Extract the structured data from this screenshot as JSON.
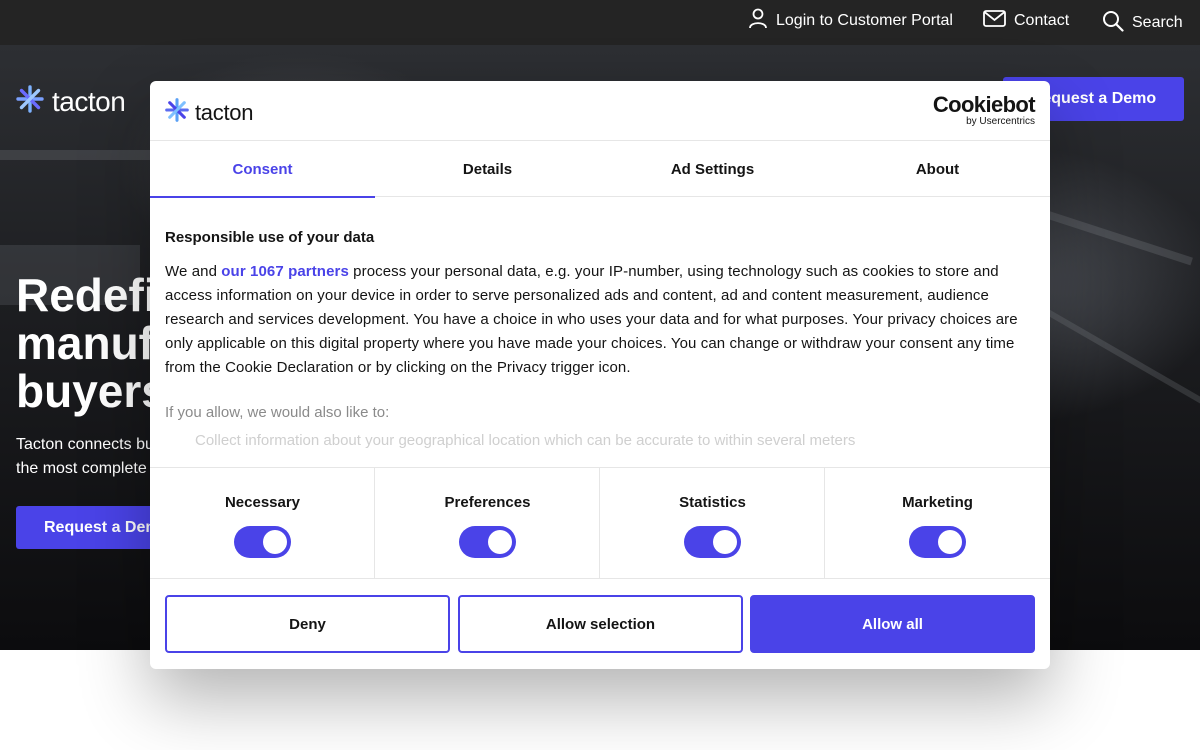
{
  "topbar": {
    "login_label": "Login to Customer Portal",
    "contact_label": "Contact",
    "search_label": "Search"
  },
  "hero": {
    "logo_text": "tacton",
    "cta_top_label": "Request a Demo",
    "heading_lines": [
      "Redefi",
      "manuf",
      "buyers"
    ],
    "sub_lines": [
      "Tacton connects bu",
      "the most complete "
    ],
    "cta_label": "Request a Demo"
  },
  "dialog": {
    "logo_text": "tacton",
    "provider_main": "Cookiebot",
    "provider_sub": "by Usercentrics",
    "tabs": [
      {
        "label": "Consent",
        "active": true
      },
      {
        "label": "Details",
        "active": false
      },
      {
        "label": "Ad Settings",
        "active": false
      },
      {
        "label": "About",
        "active": false
      }
    ],
    "title": "Responsible use of your data",
    "text_prefix": "We and ",
    "partners_link": "our 1067 partners",
    "text_rest": " process your personal data, e.g. your IP-number, using technology such as cookies to store and access information on your device in order to serve personalized ads and content, ad and content measurement, audience research and services development. You have a choice in who uses your data and for what purposes. Your privacy choices are only applicable on this digital property where you have made your choices. You can change or withdraw your consent any time from the Cookie Declaration or by clicking on the Privacy trigger icon.",
    "allow_intro": "If you allow, we would also like to:",
    "allow_item": "Collect information about your geographical location which can be accurate to within several meters",
    "toggles": [
      {
        "label": "Necessary",
        "on": true
      },
      {
        "label": "Preferences",
        "on": true
      },
      {
        "label": "Statistics",
        "on": true
      },
      {
        "label": "Marketing",
        "on": true
      }
    ],
    "buttons": {
      "deny": "Deny",
      "allow_selection": "Allow selection",
      "allow_all": "Allow all"
    },
    "accent_color": "#4a43e8"
  }
}
